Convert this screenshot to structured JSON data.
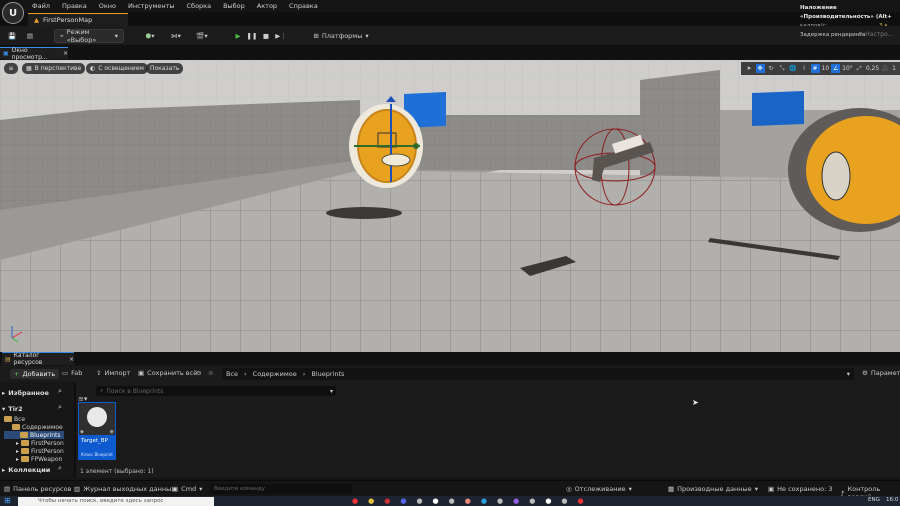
{
  "app": {
    "logo": "U",
    "menu": [
      "Файл",
      "Правка",
      "Окно",
      "Инструменты",
      "Сборка",
      "Выбор",
      "Актор",
      "Справка"
    ],
    "document_tab": "FirstPersonMap",
    "perf_note_lines": [
      "Наложение «Производительность» (Alt+...)",
      "кадров/с",
      "3 к",
      "Задержка рендеринга",
      "Настро..."
    ],
    "perf_note": "Наложение «Производительность» (Alt+",
    "perf_fps_label": "кадров/с:",
    "perf_fps_value": "3 к",
    "perf_latency": "Задержка рендеринга",
    "perf_settings": "Настро..."
  },
  "toolbar": {
    "mode_label": "Режим «Выбор»",
    "platforms_label": "Платформы"
  },
  "viewport": {
    "tab_label": "Окно просмотр...",
    "perspective_label": "В перспективе",
    "lit_label": "С освещением",
    "show_label": "Показать",
    "grid_snap": "10",
    "rotation_snap": "10°",
    "scale_snap": "0,25",
    "camera_speed": "1"
  },
  "content_browser": {
    "tab_label": "Каталог ресурсов",
    "add_label": "Добавить",
    "fab_label": "Fab",
    "import_label": "Импорт",
    "save_all_label": "Сохранить всё",
    "breadcrumb": [
      "Все",
      "Содержимое",
      "Blueprints"
    ],
    "settings_label": "Парамет",
    "favorites_label": "Избранное",
    "project_label": "Tir2",
    "search_placeholder": "Поиск в Blueprints",
    "tree": [
      {
        "label": "Все",
        "indent": 0
      },
      {
        "label": "Содержимое",
        "indent": 1
      },
      {
        "label": "Blueprints",
        "indent": 2,
        "selected": true
      },
      {
        "label": "FirstPerson",
        "indent": 2
      },
      {
        "label": "FirstPerson",
        "indent": 2
      },
      {
        "label": "FPWeapon",
        "indent": 2
      }
    ],
    "collections_label": "Коллекции",
    "asset_name": "Target_BP",
    "asset_type": "Класс Blueprint",
    "item_count": "1 элемент (выбрано: 1)"
  },
  "statusbar": {
    "drawer_label": "Панель ресурсов",
    "output_log_label": "Журнал выходных данных",
    "cmd_label": "Cmd",
    "cmd_placeholder": "Введите команду",
    "trace_label": "Отслеживание",
    "derived_label": "Производные данные",
    "unsaved_label": "Не сохранено: 3",
    "source_control_label": "Контроль версий"
  },
  "taskbar": {
    "search_placeholder": "Чтобы начать поиск, введите здесь запрос",
    "clock": "16:0",
    "lang": "ENG"
  },
  "colors": {
    "accent_blue": "#1e6fd6",
    "play_green": "#4cc34c",
    "folder": "#c9a050",
    "selection_blue": "#0e5bd0"
  }
}
